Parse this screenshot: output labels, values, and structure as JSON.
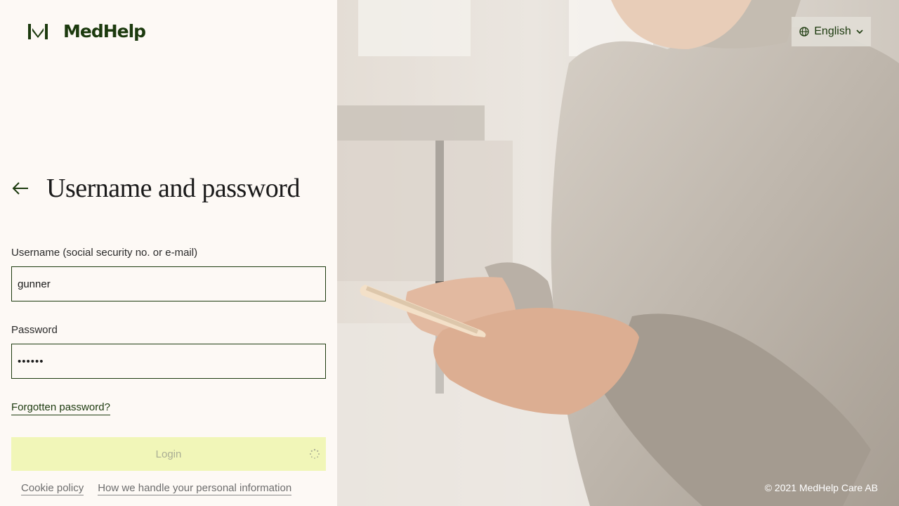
{
  "brand": {
    "logo_text": "MedHelp",
    "logo_icon": "medhelp-logo-mark"
  },
  "form": {
    "title": "Username and password",
    "username_label": "Username (social security no. or e-mail)",
    "username_value": "gunner",
    "password_label": "Password",
    "password_value": "••••••",
    "forgot_password": "Forgotten password?",
    "login_label": "Login"
  },
  "footer": {
    "cookie_policy": "Cookie policy",
    "privacy": "How we handle your personal information",
    "copyright": "© 2021 MedHelp Care AB"
  },
  "language": {
    "selected": "English"
  },
  "colors": {
    "brand_green": "#1c3a0e",
    "panel_bg": "#fdf9f5",
    "login_bg": "#f1f6b8"
  },
  "icons": [
    "back-arrow-icon",
    "globe-icon",
    "chevron-down-icon",
    "spinner-icon"
  ]
}
